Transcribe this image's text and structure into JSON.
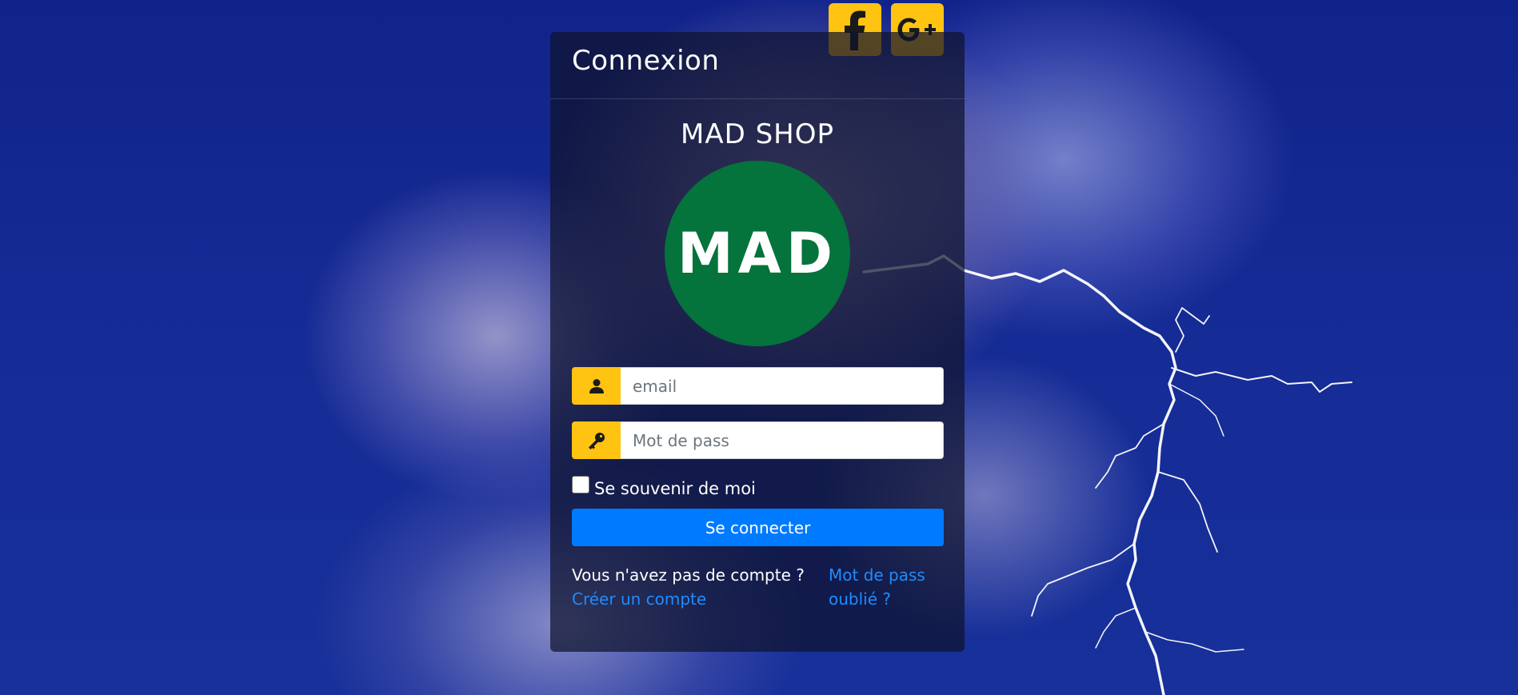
{
  "page": {
    "background": "stormy-sky-lightning"
  },
  "social": {
    "facebook_icon": "facebook-icon",
    "google_plus_label": "G+"
  },
  "card": {
    "title": "Connexion",
    "shop_name": "MAD SHOP",
    "logo_text": "MAD",
    "logo_color": "#04733c"
  },
  "form": {
    "email": {
      "icon": "user-icon",
      "placeholder": "email",
      "value": ""
    },
    "password": {
      "icon": "key-icon",
      "placeholder": "Mot de pass",
      "value": ""
    },
    "remember_label": "Se souvenir de moi",
    "remember_checked": false,
    "submit_label": "Se connecter"
  },
  "footer": {
    "no_account_text": "Vous n'avez pas de compte ?",
    "create_account_link": "Créer un compte",
    "forgot_password_line1": "Mot de pass",
    "forgot_password_line2": "oublié ?"
  },
  "colors": {
    "accent_yellow": "#ffc312",
    "primary_blue": "#007bff",
    "link_blue": "#1e8cff"
  }
}
